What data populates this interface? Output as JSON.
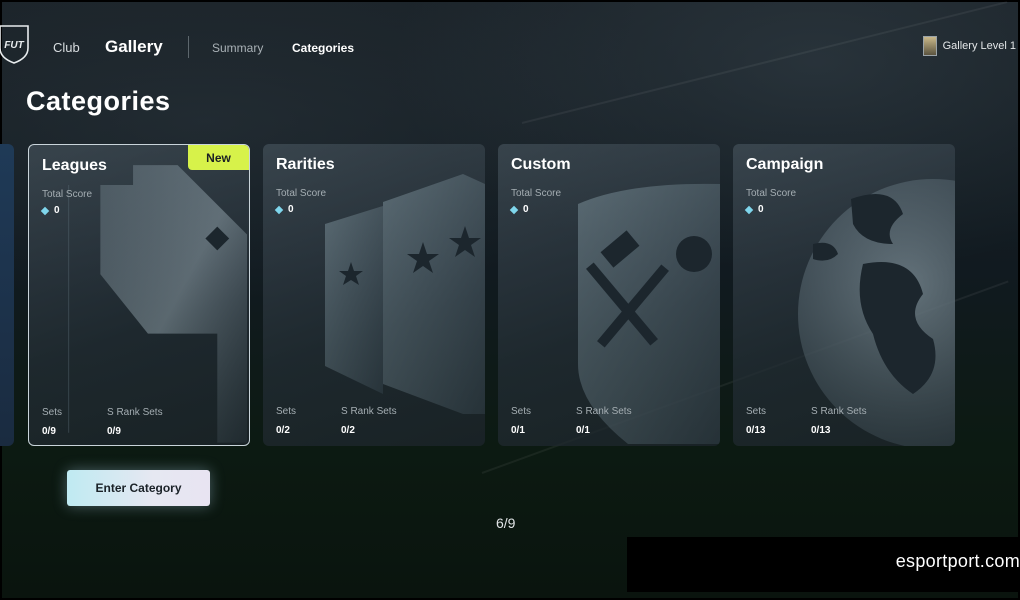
{
  "nav": {
    "logo_text": "FUT",
    "club": "Club",
    "gallery": "Gallery",
    "summary": "Summary",
    "categories": "Categories",
    "level": "Gallery Level 1"
  },
  "page_title": "Categories",
  "cards": [
    {
      "name": "Leagues",
      "total_score_label": "Total Score",
      "total_score": "0",
      "sets_label": "Sets",
      "sets": "0/9",
      "srank_label": "S Rank Sets",
      "srank": "0/9",
      "badge": "New",
      "selected": true,
      "art": "league-shield-icon"
    },
    {
      "name": "Rarities",
      "total_score_label": "Total Score",
      "total_score": "0",
      "sets_label": "Sets",
      "sets": "0/2",
      "srank_label": "S Rank Sets",
      "srank": "0/2",
      "art": "star-shields-icon"
    },
    {
      "name": "Custom",
      "total_score_label": "Total Score",
      "total_score": "0",
      "sets_label": "Sets",
      "sets": "0/1",
      "srank_label": "S Rank Sets",
      "srank": "0/1",
      "art": "hammer-wrench-icon"
    },
    {
      "name": "Campaign",
      "total_score_label": "Total Score",
      "total_score": "0",
      "sets_label": "Sets",
      "sets": "0/13",
      "srank_label": "S Rank Sets",
      "srank": "0/13",
      "art": "globe-icon"
    }
  ],
  "enter_button": "Enter Category",
  "pager": "6/9",
  "watermark": "esportport.com",
  "colors": {
    "badge": "#d7f24a",
    "gem": "#7fd6ec",
    "selected_border": "#c9d4da"
  }
}
